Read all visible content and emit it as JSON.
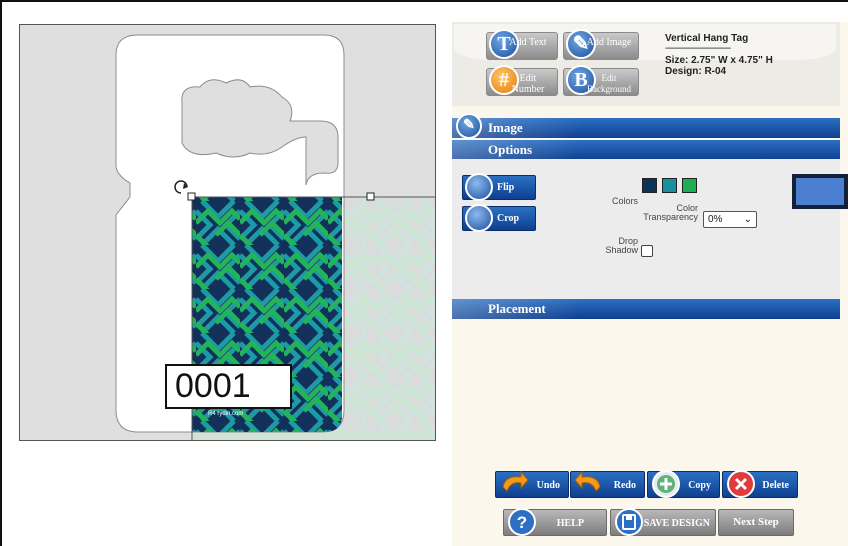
{
  "tag": {
    "number": "0001",
    "small_print": "R4  rydin.com"
  },
  "toolbox": {
    "add_text": "Add Text",
    "add_image": "Add Image",
    "edit_number": "Edit Number",
    "edit_background": "Edit Background"
  },
  "product": {
    "name": "Vertical Hang Tag",
    "divider": "----------------------------",
    "size": "Size: 2.75\" W x 4.75\" H",
    "design": "Design: R-04"
  },
  "panels": {
    "image": "Image",
    "options": "Options",
    "placement": "Placement"
  },
  "options": {
    "flip": "Flip",
    "crop": "Crop",
    "colors_label": "Colors",
    "color_transparency_line1": "Color",
    "color_transparency_line2": "Transparency",
    "transparency_value": "0%",
    "drop_shadow_line1": "Drop",
    "drop_shadow_line2": "Shadow",
    "swatches": [
      "#0f3257",
      "#1a8fa0",
      "#1fae55"
    ],
    "preview_color": "#4b7fd1"
  },
  "actions": {
    "undo": "Undo",
    "redo": "Redo",
    "copy": "Copy",
    "delete": "Delete",
    "help": "HELP",
    "save_design": "SAVE DESIGN",
    "next_step": "Next Step"
  }
}
